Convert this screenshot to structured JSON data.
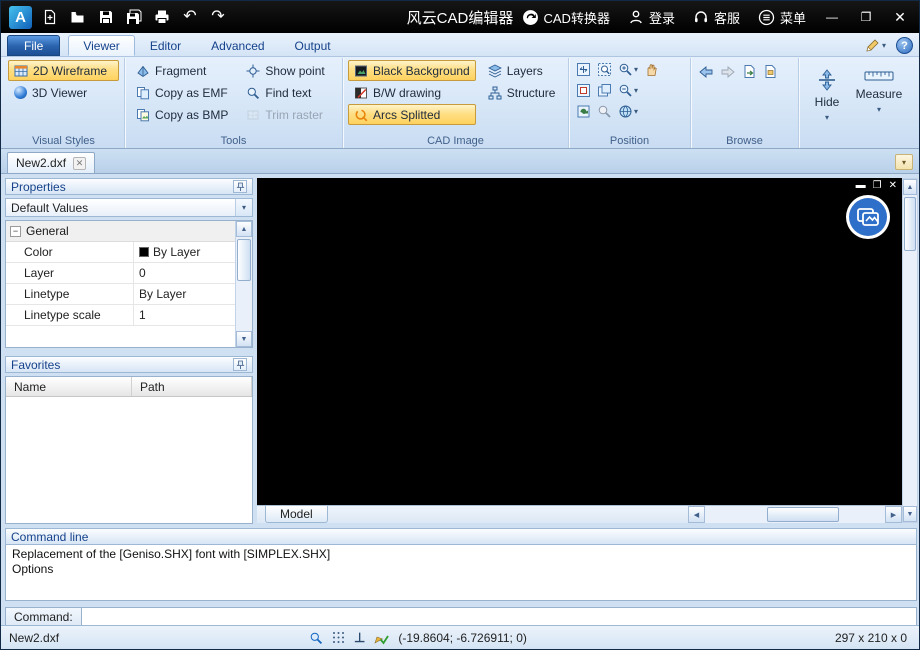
{
  "colors": {
    "selected_highlight": "#FFD25E",
    "header_text": "#15428B",
    "canvas_bg": "#000000",
    "titlebar_bg": "#000000",
    "file_button_blue": "#2A62AC"
  },
  "icons": {
    "dropdown": "▾",
    "minimize": "—",
    "maximize": "❐",
    "close": "✕",
    "undo": "↶",
    "redo": "↷",
    "up_arrow": "▲",
    "down_arrow": "▼",
    "left_arrow": "◀",
    "right_arrow": "▶",
    "help": "?",
    "ortho": "⊥",
    "tab_close": "✕",
    "collapse": "−",
    "pencil": "✎",
    "scissors": "✂",
    "mdi_minimize": "▬",
    "mdi_restore": "❐",
    "mdi_close": "✕"
  },
  "titlebar": {
    "title": "风云CAD编辑器",
    "links": [
      {
        "label": "CAD转换器"
      },
      {
        "label": "登录"
      },
      {
        "label": "客服"
      },
      {
        "label": "菜单"
      }
    ]
  },
  "menubar": {
    "file": "File",
    "tabs": [
      {
        "label": "Viewer"
      },
      {
        "label": "Editor"
      },
      {
        "label": "Advanced"
      },
      {
        "label": "Output"
      }
    ]
  },
  "ribbon": {
    "visual_styles": {
      "label": "Visual Styles",
      "items": [
        {
          "label": "2D Wireframe"
        },
        {
          "label": "3D Viewer"
        }
      ]
    },
    "tools": {
      "label": "Tools",
      "col1": [
        {
          "label": "Fragment"
        },
        {
          "label": "Copy as EMF"
        },
        {
          "label": "Copy as BMP"
        }
      ],
      "col2": [
        {
          "label": "Show point"
        },
        {
          "label": "Find text"
        },
        {
          "label": "Trim raster"
        }
      ]
    },
    "cad_image": {
      "label": "CAD Image",
      "col1": [
        {
          "label": "Black Background"
        },
        {
          "label": "B/W drawing"
        },
        {
          "label": "Arcs Splitted"
        }
      ],
      "col2": [
        {
          "label": "Layers"
        },
        {
          "label": "Structure"
        }
      ]
    },
    "position": {
      "label": "Position"
    },
    "browse": {
      "label": "Browse"
    },
    "hide_button": "Hide",
    "measure_button": "Measure"
  },
  "document_tabs": [
    {
      "name": "New2.dxf"
    }
  ],
  "properties": {
    "title": "Properties",
    "preset": "Default Values",
    "group": "General",
    "rows": [
      {
        "name": "Color",
        "value": "By Layer"
      },
      {
        "name": "Layer",
        "value": "0"
      },
      {
        "name": "Linetype",
        "value": "By Layer"
      },
      {
        "name": "Linetype scale",
        "value": "1"
      }
    ]
  },
  "favorites": {
    "title": "Favorites",
    "columns": [
      "Name",
      "Path"
    ]
  },
  "canvas": {
    "model_tab": "Model"
  },
  "command": {
    "title": "Command line",
    "lines": [
      "Replacement of the [Geniso.SHX] font with [SIMPLEX.SHX]",
      "Options"
    ],
    "prompt": "Command:",
    "value": ""
  },
  "statusbar": {
    "filename": "New2.dxf",
    "coordinates": "(-19.8604; -6.726911; 0)",
    "size": "297 x 210 x 0"
  }
}
